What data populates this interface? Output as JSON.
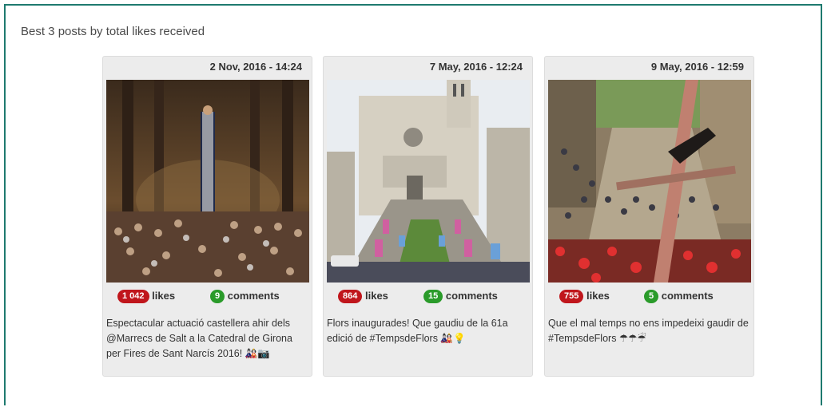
{
  "title": "Best 3 posts by total likes received",
  "posts": [
    {
      "date": "2 Nov, 2016 - 14:24",
      "likes": "1 042",
      "likes_label": "likes",
      "comments": "9",
      "comments_label": "comments",
      "caption": "Espectacular actuació castellera ahir dels @Marrecs de Salt a la Catedral de Girona per Fires de Sant Narcís 2016! 🎎📷"
    },
    {
      "date": "7 May, 2016 - 12:24",
      "likes": "864",
      "likes_label": "likes",
      "comments": "15",
      "comments_label": "comments",
      "caption": "Flors inaugurades! Que gaudiu de la 61a edició de #TempsdeFlors 🎎💡"
    },
    {
      "date": "9 May, 2016 - 12:59",
      "likes": "755",
      "likes_label": "likes",
      "comments": "5",
      "comments_label": "comments",
      "caption": "Que el mal temps no ens impedeixi gaudir de #TempsdeFlors ☂☂☔"
    }
  ]
}
